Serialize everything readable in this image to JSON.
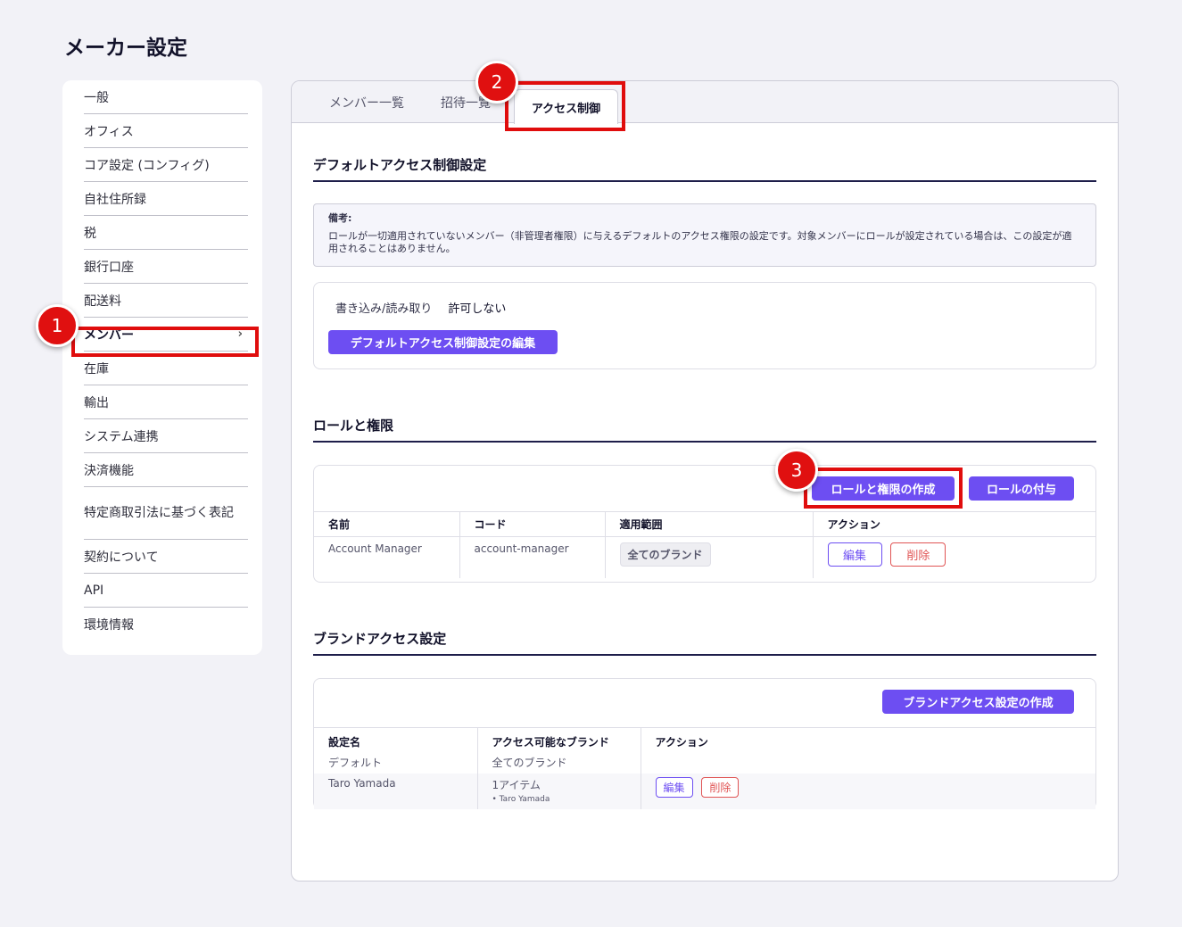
{
  "page_title": "メーカー設定",
  "sidebar": {
    "items": [
      {
        "label": "一般"
      },
      {
        "label": "オフィス"
      },
      {
        "label": "コア設定 (コンフィグ)"
      },
      {
        "label": "自社住所録"
      },
      {
        "label": "税"
      },
      {
        "label": "銀行口座"
      },
      {
        "label": "配送料"
      },
      {
        "label": "メンバー",
        "active": true
      },
      {
        "label": "在庫"
      },
      {
        "label": "輸出"
      },
      {
        "label": "システム連携"
      },
      {
        "label": "決済機能"
      },
      {
        "label": "特定商取引法に基づく表記"
      },
      {
        "label": "契約について"
      },
      {
        "label": "API"
      },
      {
        "label": "環境情報"
      }
    ],
    "chevron": "›"
  },
  "tabs": [
    {
      "label": "メンバー一覧"
    },
    {
      "label": "招待一覧"
    },
    {
      "label": "アクセス制御",
      "active": true
    }
  ],
  "default_access": {
    "title": "デフォルトアクセス制御設定",
    "note_title": "備考:",
    "note_text": "ロールが一切適用されていないメンバー（非管理者権限）に与えるデフォルトのアクセス権限の設定です。対象メンバーにロールが設定されている場合は、この設定が適用されることはありません。",
    "permission_label": "書き込み/読み取り",
    "permission_value": "許可しない",
    "edit_button": "デフォルトアクセス制御設定の編集"
  },
  "roles": {
    "title": "ロールと権限",
    "create_button": "ロールと権限の作成",
    "assign_button": "ロールの付与",
    "columns": [
      "名前",
      "コード",
      "適用範囲",
      "アクション"
    ],
    "rows": [
      {
        "name": "Account Manager",
        "code": "account-manager",
        "scope": "全てのブランド",
        "edit": "編集",
        "delete": "削除"
      }
    ]
  },
  "brand_access": {
    "title": "ブランドアクセス設定",
    "create_button": "ブランドアクセス設定の作成",
    "columns": [
      "設定名",
      "アクセス可能なブランド",
      "アクション"
    ],
    "rows": [
      {
        "name": "デフォルト",
        "brands": "全てのブランド",
        "sub": ""
      },
      {
        "name": "Taro Yamada",
        "brands": "1アイテム",
        "sub": "Taro Yamada",
        "edit": "編集",
        "delete": "削除"
      }
    ]
  },
  "annotations": {
    "badge1": "1",
    "badge2": "2",
    "badge3": "3",
    "highlight_color": "#e00d0d"
  },
  "colors": {
    "accent": "#6d4ef2",
    "danger": "#e05454",
    "rule": "#1e1e4a"
  }
}
